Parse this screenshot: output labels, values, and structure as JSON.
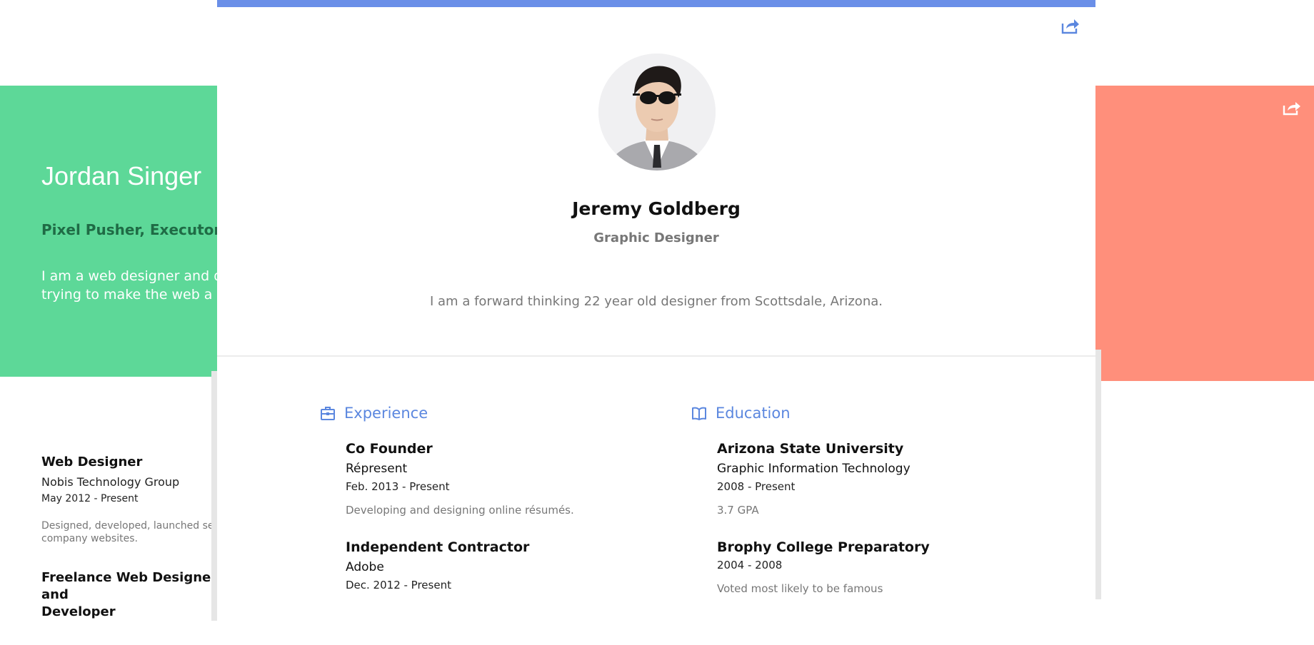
{
  "left_profile": {
    "name": "Jordan Singer",
    "tagline": "Pixel Pusher, Executor, Ma",
    "bio": "I am a web designer and de\ntrying to make the web a b",
    "jobs": [
      {
        "title": "Web Designer",
        "org": "Nobis Technology Group",
        "date": "May 2012 - Present",
        "desc": "Designed, developed, launched seve\ncompany websites."
      },
      {
        "title": "Freelance Web Designer and\nDeveloper",
        "org": "",
        "date": "",
        "desc": ""
      }
    ]
  },
  "main_profile": {
    "name": "Jeremy Goldberg",
    "role": "Graphic Designer",
    "bio": "I am a forward thinking 22 year old designer from Scottsdale, Arizona.",
    "avatar_icon": "profile-photo"
  },
  "experience": {
    "heading": "Experience",
    "icon": "briefcase-icon",
    "entries": [
      {
        "title": "Co Founder",
        "org": "Répresent",
        "date": "Feb. 2013 - Present",
        "desc": "Developing and designing online résumés."
      },
      {
        "title": "Independent Contractor",
        "org": "Adobe",
        "date": "Dec. 2012 - Present",
        "desc": ""
      }
    ]
  },
  "education": {
    "heading": "Education",
    "icon": "book-icon",
    "entries": [
      {
        "title": "Arizona State University",
        "org": "Graphic Information Technology",
        "date": "2008 - Present",
        "desc": "3.7 GPA"
      },
      {
        "title": "Brophy College Preparatory",
        "org": "",
        "date": "2004 - 2008",
        "desc": "Voted most likely to be famous"
      }
    ]
  },
  "colors": {
    "accent": "#6a8fe8",
    "left_card": "#5dd898",
    "right_card": "#ff8f7b"
  }
}
